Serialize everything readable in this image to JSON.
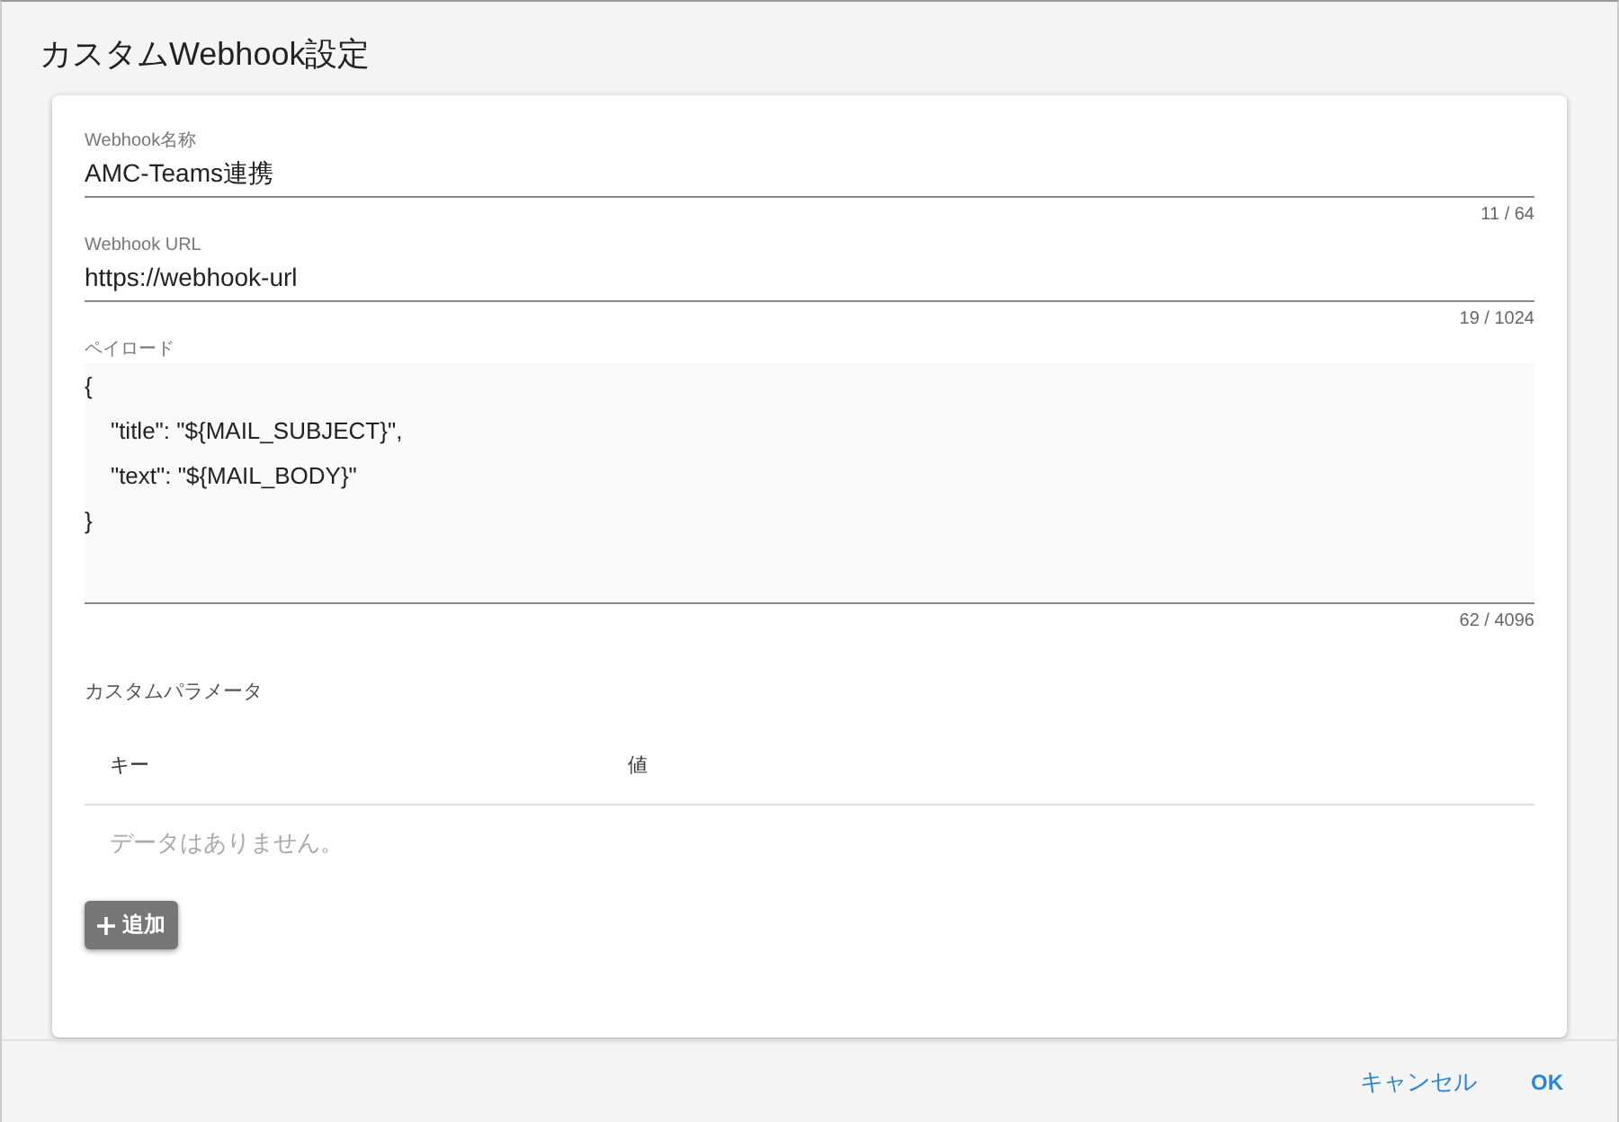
{
  "dialog": {
    "title": "カスタムWebhook設定"
  },
  "fields": [
    {
      "kind": "line",
      "label": "Webhook名称",
      "value": "AMC-Teams連携",
      "counter": "11 / 64"
    },
    {
      "kind": "line",
      "label": "Webhook URL",
      "value": "https://webhook-url",
      "counter": "19 / 1024"
    },
    {
      "kind": "area",
      "label": "ペイロード",
      "value": "{\n    \"title\": \"${MAIL_SUBJECT}\",\n    \"text\": \"${MAIL_BODY}\"\n}",
      "counter": "62 / 4096"
    }
  ],
  "custom_parameters": {
    "title": "カスタムパラメータ",
    "columns": [
      "キー",
      "値"
    ],
    "empty_text": "データはありません。",
    "add_button": "追加"
  },
  "buttons": [
    {
      "label": "キャンセル",
      "kind": "secondary"
    },
    {
      "label": "OK",
      "kind": "primary"
    }
  ]
}
